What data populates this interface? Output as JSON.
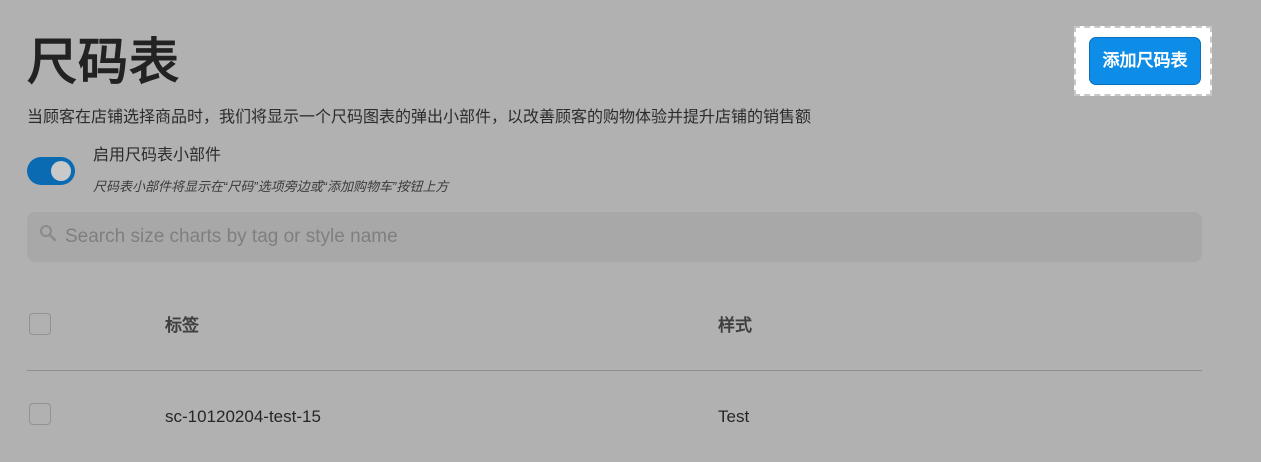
{
  "header": {
    "title": "尺码表",
    "add_button_label": "添加尺码表"
  },
  "description": "当顾客在店铺选择商品时，我们将显示一个尺码图表的弹出小部件，以改善顾客的购物体验并提升店铺的销售额",
  "widget_toggle": {
    "enabled": true,
    "label": "启用尺码表小部件",
    "hint": "尺码表小部件将显示在“尺码”选项旁边或“添加购物车”按钮上方"
  },
  "search": {
    "placeholder": "Search size charts by tag or style name",
    "value": ""
  },
  "table": {
    "columns": {
      "tag": "标签",
      "style": "样式"
    },
    "rows": [
      {
        "tag": "sc-10120204-test-15",
        "style": "Test",
        "checked": false
      }
    ]
  },
  "colors": {
    "primary": "#0e8de8",
    "toggle_on": "#0a6bb3",
    "background": "#b1b1b1"
  }
}
